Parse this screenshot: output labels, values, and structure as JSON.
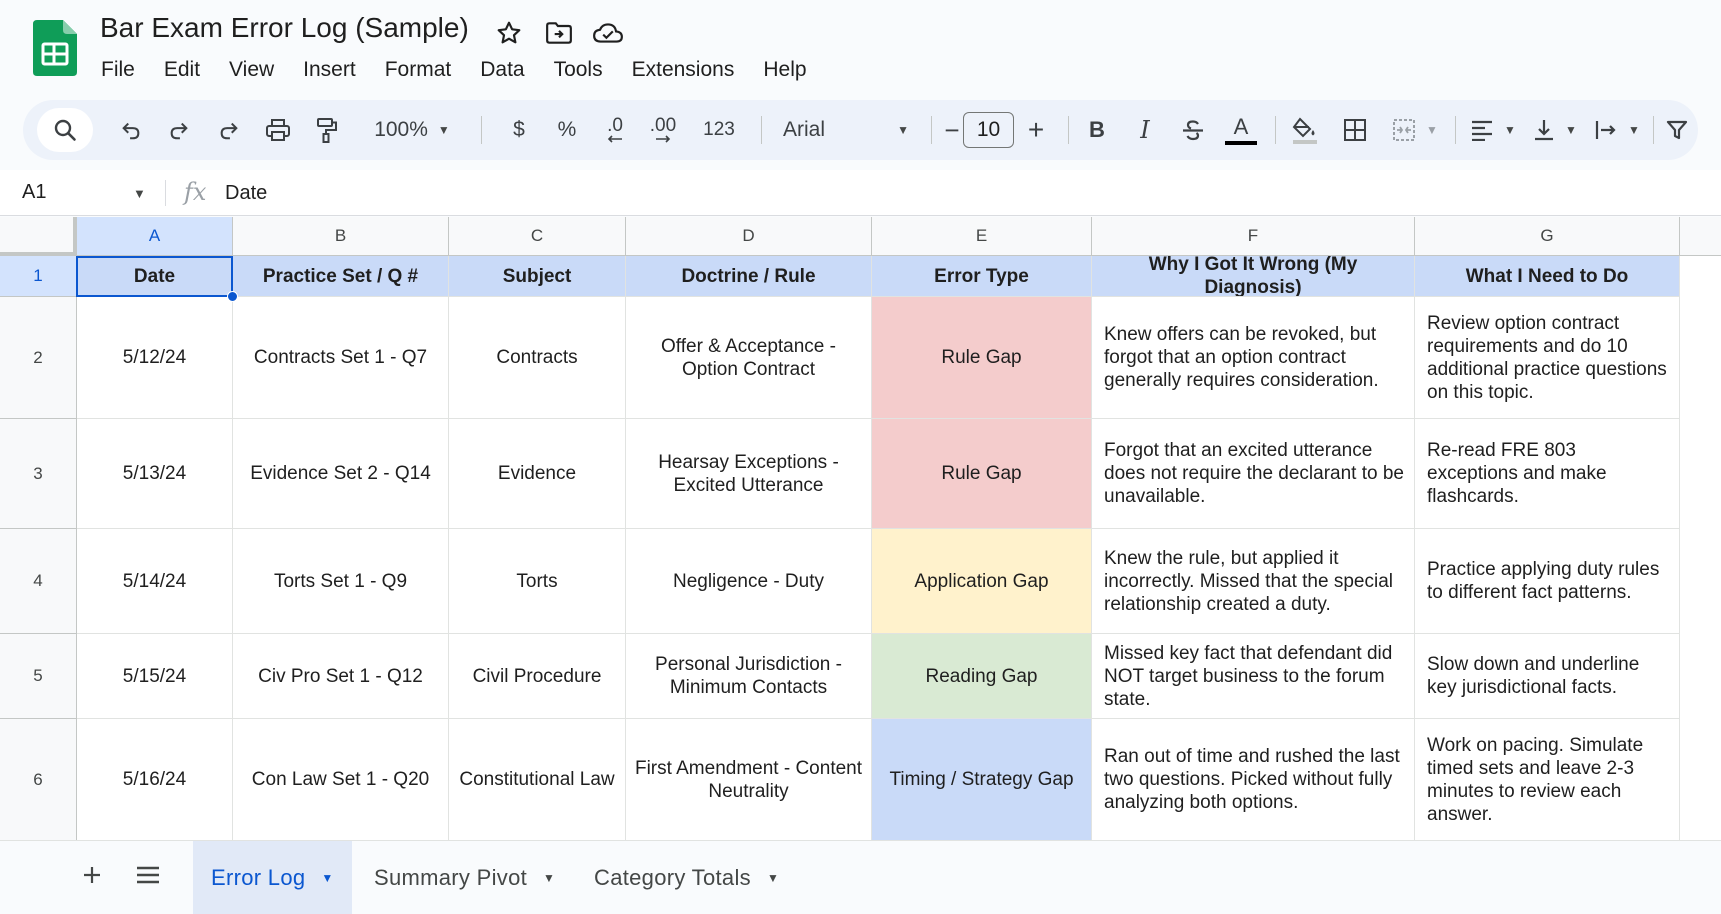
{
  "app": {
    "title": "Bar Exam Error Log (Sample)",
    "logo_icon": "sheets-logo-icon",
    "title_icons": [
      "star-icon",
      "move-to-folder-icon",
      "cloud-saved-icon"
    ],
    "colors": {
      "brand_green": "#0f9d58",
      "accent_blue": "#0b57d0"
    }
  },
  "menu": [
    "File",
    "Edit",
    "View",
    "Insert",
    "Format",
    "Data",
    "Tools",
    "Extensions",
    "Help"
  ],
  "toolbar": {
    "zoom": "100%",
    "currency": "$",
    "percent": "%",
    "decrease_decimal": ".0",
    "increase_decimal": ".00",
    "number_format": "123",
    "font": "Arial",
    "font_size": "10",
    "minus": "−",
    "plus": "+",
    "bold": "B",
    "italic": "I",
    "text_color": "A"
  },
  "formula_bar": {
    "name_box": "A1",
    "fx": "fx",
    "value": "Date"
  },
  "grid": {
    "columns": [
      "A",
      "B",
      "C",
      "D",
      "E",
      "F",
      "G"
    ],
    "rows": [
      "1",
      "2",
      "3",
      "4",
      "5",
      "6"
    ],
    "headers": [
      "Date",
      "Practice Set / Q #",
      "Subject",
      "Doctrine / Rule",
      "Error Type",
      "Why I Got It Wrong (My Diagnosis)",
      "What I Need to Do"
    ],
    "data": [
      [
        "5/12/24",
        "Contracts Set 1 - Q7",
        "Contracts",
        "Offer & Acceptance - Option Contract",
        "Rule Gap",
        "Knew offers can be revoked, but forgot that an option contract generally requires consideration.",
        "Review option contract requirements and do 10 additional practice questions on this topic."
      ],
      [
        "5/13/24",
        "Evidence Set 2 - Q14",
        "Evidence",
        "Hearsay Exceptions - Excited Utterance",
        "Rule Gap",
        "Forgot that an excited utterance does not require the declarant to be unavailable.",
        "Re-read FRE 803 exceptions and make flashcards."
      ],
      [
        "5/14/24",
        "Torts Set 1 - Q9",
        "Torts",
        "Negligence - Duty",
        "Application Gap",
        "Knew the rule, but applied it incorrectly. Missed that the special relationship created a duty.",
        "Practice applying duty rules to different fact patterns."
      ],
      [
        "5/15/24",
        "Civ Pro Set 1 - Q12",
        "Civil Procedure",
        "Personal Jurisdiction - Minimum Contacts",
        "Reading Gap",
        "Missed key fact that defendant did NOT target business to the forum state.",
        "Slow down and underline key jurisdictional facts."
      ],
      [
        "5/16/24",
        "Con Law Set 1 - Q20",
        "Constitutional Law",
        "First Amendment - Content Neutrality",
        "Timing / Strategy Gap",
        "Ran out of time and rushed the last two questions. Picked without fully analyzing both options.",
        "Work on pacing. Simulate timed sets and leave 2-3 minutes to review each answer."
      ]
    ],
    "error_type_colors": {
      "Rule Gap": "#f4cccc",
      "Application Gap": "#fff2cc",
      "Reading Gap": "#d9ead3",
      "Timing / Strategy Gap": "#c9daf8"
    },
    "header_color": "#c9daf8"
  },
  "sheets": {
    "tabs": [
      {
        "label": "Error Log",
        "active": true
      },
      {
        "label": "Summary Pivot",
        "active": false
      },
      {
        "label": "Category Totals",
        "active": false
      }
    ]
  }
}
